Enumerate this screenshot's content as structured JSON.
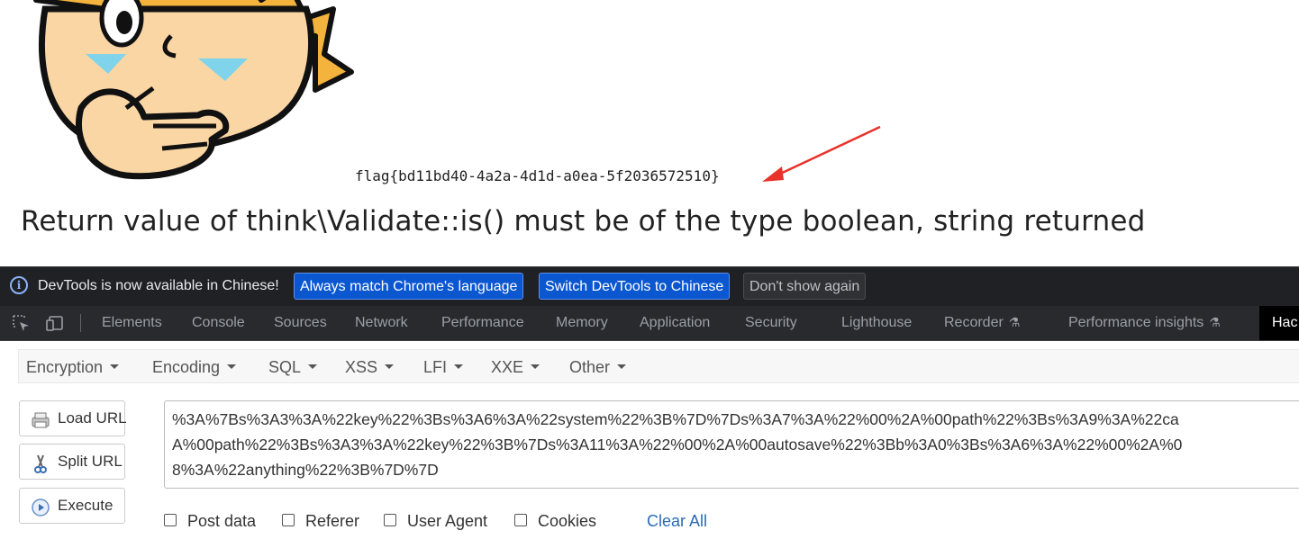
{
  "page": {
    "flag_text": "flag{bd11bd40-4a2a-4d1d-a0ea-5f2036572510}",
    "error_text": "Return value of think\\Validate::is() must be of the type boolean, string returned",
    "annotation_arrow_color": "#e8322a"
  },
  "devtools": {
    "infobar": {
      "message": "DevTools is now available in Chinese!",
      "buttons": [
        "Always match Chrome's language",
        "Switch DevTools to Chinese",
        "Don't show again"
      ]
    },
    "tabs": [
      "Elements",
      "Console",
      "Sources",
      "Network",
      "Performance",
      "Memory",
      "Application",
      "Security",
      "Lighthouse",
      "Recorder",
      "Performance insights",
      "Hac"
    ]
  },
  "hackbar": {
    "menus": [
      "Encryption",
      "Encoding",
      "SQL",
      "XSS",
      "LFI",
      "XXE",
      "Other"
    ],
    "buttons": {
      "load_url": "Load URL",
      "split_url": "Split URL",
      "execute": "Execute"
    },
    "url_lines": [
      "%3A%7Bs%3A3%3A%22key%22%3Bs%3A6%3A%22system%22%3B%7D%7Ds%3A7%3A%22%00%2A%00path%22%3Bs%3A9%3A%22ca",
      "A%00path%22%3Bs%3A3%3A%22key%22%3B%7Ds%3A11%3A%22%00%2A%00autosave%22%3Bb%3A0%3Bs%3A6%3A%22%00%2A%0",
      "8%3A%22anything%22%3B%7D%7D"
    ],
    "checkboxes": [
      "Post data",
      "Referer",
      "User Agent",
      "Cookies"
    ],
    "checked": [
      false,
      false,
      false,
      false
    ],
    "clear_all": "Clear All"
  }
}
